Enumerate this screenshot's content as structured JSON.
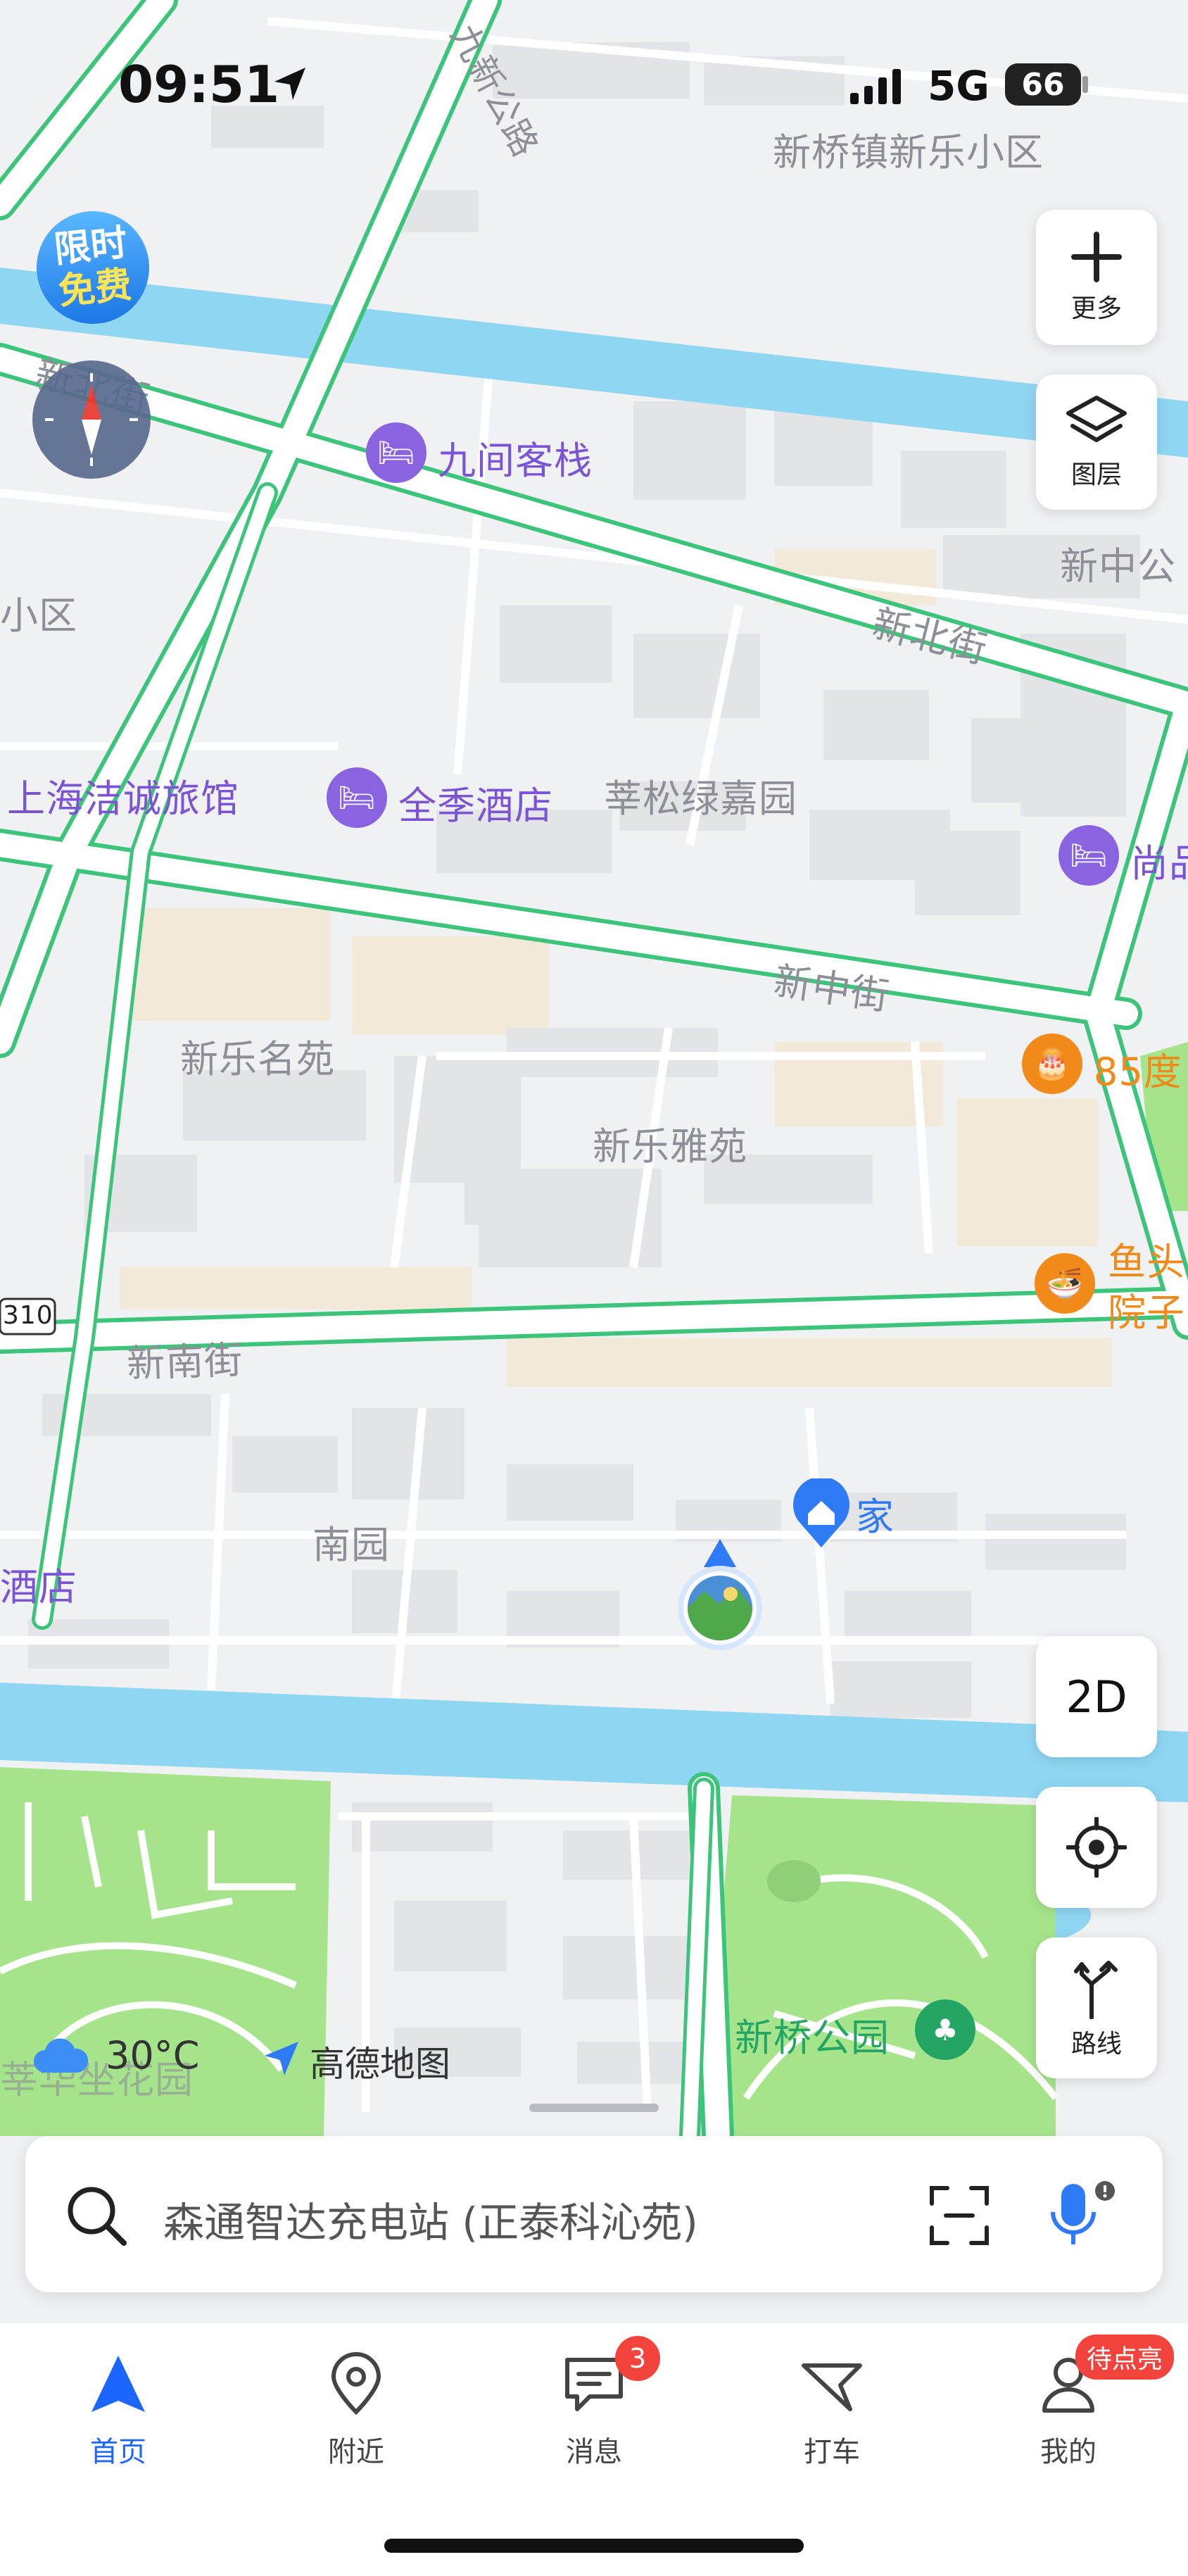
{
  "status_bar": {
    "time": "09:51",
    "network": "5G",
    "battery": "66"
  },
  "promo_badge": {
    "line1": "限时",
    "line2": "免费"
  },
  "map_labels": {
    "road_jiuxin": "九新公路",
    "road_xinbei_left": "新北街",
    "road_xinbei": "新北街",
    "road_xinzhong": "新中街",
    "road_xinnan": "新南街",
    "route_marker": "310",
    "xinqiao_xinle": "新桥镇新乐小区",
    "xinzhong_gong": "新中公",
    "xiaoqu": "小区",
    "shenglv": "莘松绿嘉园",
    "xinle_mingyuan": "新乐名苑",
    "xinle_yayuan": "新乐雅苑",
    "nanyuan": "南园",
    "jiudian": "酒店",
    "home": "家",
    "hualuo": "莘华坐花园"
  },
  "pois": {
    "jiujian": "九间客栈",
    "shanghai_jiecheng": "上海洁诚旅馆",
    "quanji": "全季酒店",
    "shang": "尚品",
    "du85": "85度",
    "yutou_line1": "鱼头",
    "yutou_line2": "院子",
    "xinqiao_park": "新桥公园"
  },
  "weather": {
    "temp": "30°C"
  },
  "brand": "高德地图",
  "controls": {
    "more": "更多",
    "layers": "图层",
    "mode_2d": "2D",
    "route": "路线"
  },
  "search": {
    "placeholder": "森通智达充电站 (正泰科沁苑)"
  },
  "tabs": [
    {
      "label": "首页"
    },
    {
      "label": "附近"
    },
    {
      "label": "消息",
      "badge": "3"
    },
    {
      "label": "打车"
    },
    {
      "label": "我的",
      "badge": "待点亮"
    }
  ],
  "colors": {
    "accent": "#1a66ff",
    "road_green": "#3cc47a",
    "water": "#8fd6f3",
    "park": "#a6e48c",
    "poi_purple": "#8a63e0",
    "poi_orange": "#f28a1a"
  }
}
